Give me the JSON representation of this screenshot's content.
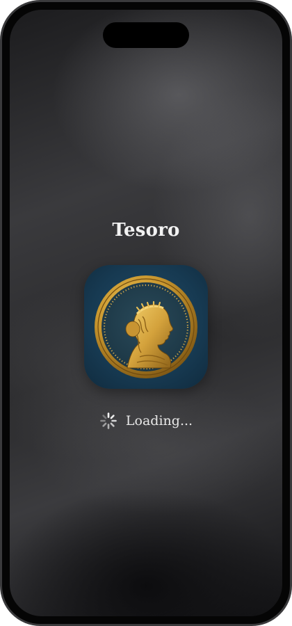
{
  "app": {
    "title": "Tesoro"
  },
  "icon": {
    "name": "coin-portrait-icon",
    "background": "#173a52",
    "coin_color": "#c8962e"
  },
  "loading": {
    "label": "Loading...",
    "spinner": "loading-spinner-icon"
  }
}
